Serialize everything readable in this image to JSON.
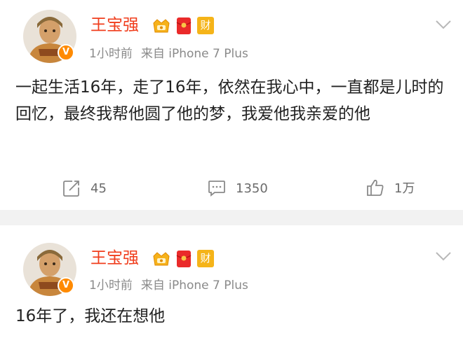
{
  "posts": [
    {
      "author": "王宝强",
      "verified": "V",
      "badges": [
        "crown-badge-icon",
        "red-envelope-icon",
        "wealth-badge-icon"
      ],
      "wealth_char": "财",
      "time": "1小时前",
      "source": "来自 iPhone 7 Plus",
      "text": "一起生活16年，走了16年，依然在我心中，一直都是儿时的回忆，最终我帮他圆了他的梦，我爱他我亲爱的他",
      "actions": {
        "repost": "45",
        "comment": "1350",
        "like": "1万"
      }
    },
    {
      "author": "王宝强",
      "verified": "V",
      "wealth_char": "财",
      "time": "1小时前",
      "source": "来自 iPhone 7 Plus",
      "text": "16年了，我还在想他"
    }
  ],
  "colors": {
    "author": "#f03d1c",
    "meta": "#8a8a8a",
    "verified_badge": "#ff8a00",
    "background": "#f2f2f2"
  }
}
